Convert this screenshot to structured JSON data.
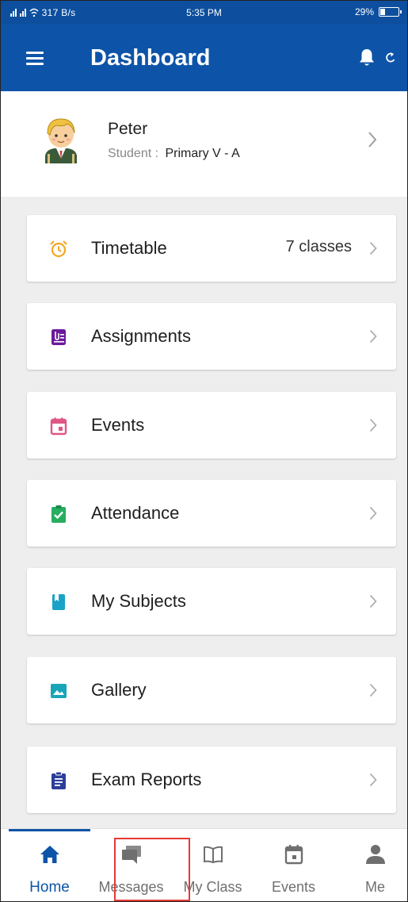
{
  "status_bar": {
    "signal_text": "³⁴‡‡ 317 B/s",
    "time": "5:35 PM",
    "battery": "29%",
    "battery_level": 0.29
  },
  "app_bar": {
    "title": "Dashboard",
    "menu_icon": "menu-icon",
    "bell_icon": "bell-icon",
    "refresh_icon": "refresh-icon"
  },
  "profile": {
    "name": "Peter",
    "role_label": "Student :",
    "class_name": "Primary V - A"
  },
  "cards": [
    {
      "label": "Timetable",
      "value": "7 classes",
      "icon": "alarm-clock-icon",
      "color": "#f5a623"
    },
    {
      "label": "Assignments",
      "value": "",
      "icon": "assignment-icon",
      "color": "#6a1b9a"
    },
    {
      "label": "Events",
      "value": "",
      "icon": "calendar-icon",
      "color": "#e05684"
    },
    {
      "label": "Attendance",
      "value": "",
      "icon": "clipboard-check-icon",
      "color": "#27ae60"
    },
    {
      "label": "My Subjects",
      "value": "",
      "icon": "book-icon",
      "color": "#1aa3c7"
    },
    {
      "label": "Gallery",
      "value": "",
      "icon": "image-icon",
      "color": "#19a5b8"
    },
    {
      "label": "Exam Reports",
      "value": "",
      "icon": "report-icon",
      "color": "#2c3e9a"
    }
  ],
  "bottom_nav": {
    "items": [
      {
        "label": "Home",
        "icon": "home-icon",
        "active": true
      },
      {
        "label": "Messages",
        "icon": "chat-icon",
        "active": false
      },
      {
        "label": "My Class",
        "icon": "open-book-icon",
        "active": false
      },
      {
        "label": "Events",
        "icon": "calendar-icon",
        "active": false
      },
      {
        "label": "Me",
        "icon": "person-icon",
        "active": false
      }
    ]
  },
  "colors": {
    "primary": "#0d54a8",
    "highlight": "#e53935"
  }
}
